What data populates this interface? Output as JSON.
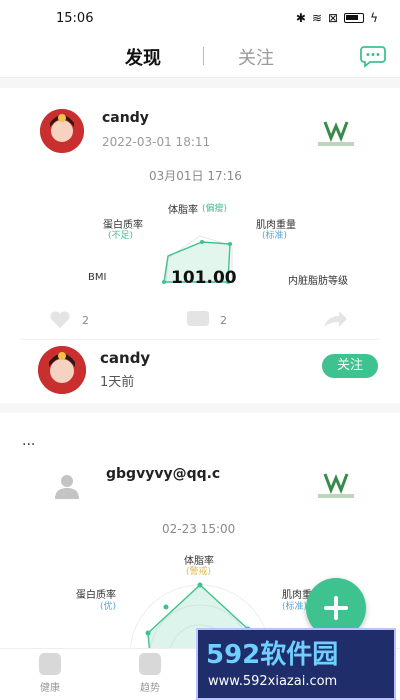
{
  "status_bar": {
    "time": "15:06"
  },
  "header": {
    "tab_active": "发现",
    "tab_inactive": "关注"
  },
  "card1": {
    "username": "candy",
    "datetime": "2022-03-01 18:11",
    "report": {
      "date": "03月01日 17:16",
      "labels": {
        "top": "体脂率",
        "top_status": "(偏瘦)",
        "left": "蛋白质率",
        "left_status": "(不足)",
        "right": "肌肉重量",
        "right_status": "(标准)",
        "bottom_left": "BMI",
        "bottom_right": "内脏脂肪等级"
      },
      "score": "101.00"
    },
    "likes": "2",
    "comments": "2"
  },
  "suggested_user": {
    "username": "candy",
    "ago": "1天前",
    "follow_label": "关注"
  },
  "card2": {
    "more": "...",
    "username": "gbgvyvy@qq.c",
    "report": {
      "date": "02-23 15:00",
      "labels": {
        "top": "体脂率",
        "top_status": "(警戒)",
        "left": "蛋白质率",
        "left_status": "(优)",
        "right": "肌肉重",
        "right_status": "(标准)"
      }
    }
  },
  "tabbar": {
    "items": [
      {
        "label": "健康"
      },
      {
        "label": "趋势"
      }
    ]
  },
  "watermark": {
    "big": "592软件园",
    "small": "www.592xiazai.com"
  },
  "colors": {
    "accent": "#3ec28f",
    "status_warn": "#e6b84a",
    "status_blue": "#5aa7d8"
  }
}
